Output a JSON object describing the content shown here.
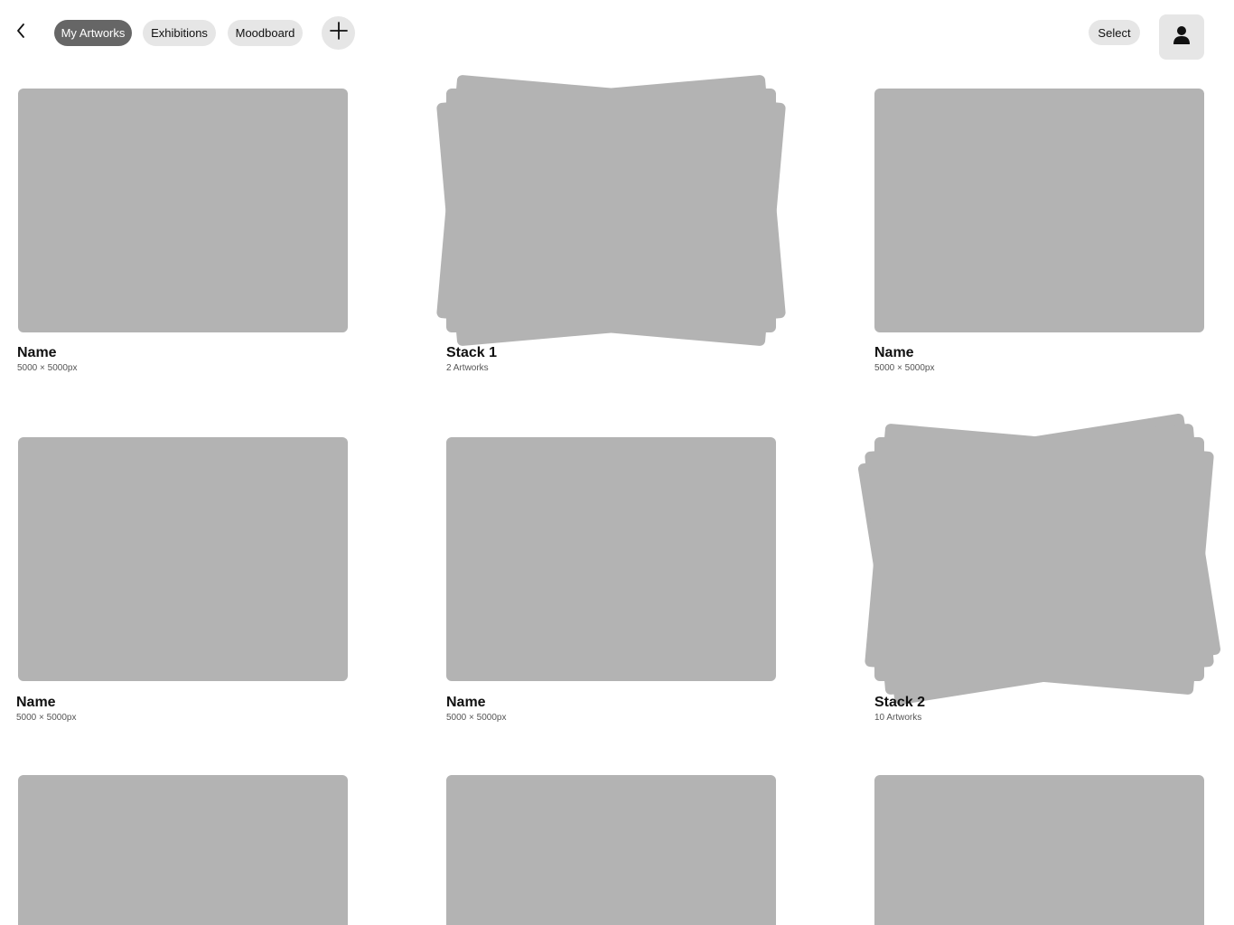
{
  "nav": {
    "tabs": [
      {
        "label": "My Artworks",
        "active": true
      },
      {
        "label": "Exhibitions",
        "active": false
      },
      {
        "label": "Moodboard",
        "active": false
      }
    ],
    "select_label": "Select"
  },
  "icons": {
    "back": "chevron-left-icon",
    "add": "plus-icon",
    "profile": "user-icon"
  },
  "colors": {
    "active_tab": "#666666",
    "pill_bg": "#e6e6e6",
    "placeholder": "#b3b3b3"
  },
  "items": [
    {
      "name": "Name",
      "sub": "5000 × 5000px",
      "type": "artwork"
    },
    {
      "name": "Stack 1",
      "sub": "2 Artworks",
      "type": "stack"
    },
    {
      "name": "Name",
      "sub": "5000 × 5000px",
      "type": "artwork"
    },
    {
      "name": "Name",
      "sub": "5000 × 5000px",
      "type": "artwork"
    },
    {
      "name": "Name",
      "sub": "5000 × 5000px",
      "type": "artwork"
    },
    {
      "name": "Stack 2",
      "sub": "10 Artworks",
      "type": "stack"
    },
    {
      "type": "artwork"
    },
    {
      "type": "artwork"
    },
    {
      "type": "artwork"
    }
  ]
}
